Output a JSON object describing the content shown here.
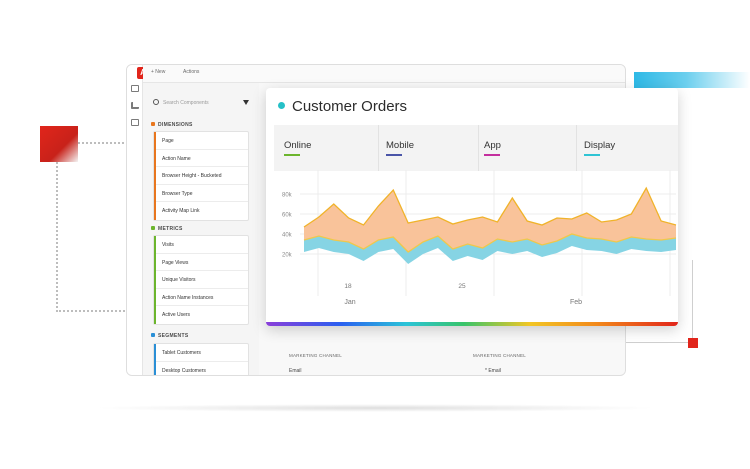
{
  "app": {
    "logo_letter": "A",
    "topbar": {
      "new_label": "+ New",
      "actions_label": "Actions"
    },
    "search": {
      "placeholder": "Search Components"
    },
    "sections": {
      "dimensions": {
        "title": "DIMENSIONS",
        "items": [
          "Page",
          "Action Name",
          "Browser Height - Bucketed",
          "Browser Type",
          "Activity Map Link"
        ]
      },
      "metrics": {
        "title": "METRICS",
        "items": [
          "Visits",
          "Page Views",
          "Unique Visitors",
          "Action Name Instances",
          "Active Users"
        ]
      },
      "segments": {
        "title": "SEGMENTS",
        "items": [
          "Tablet Customers",
          "Desktop Customers"
        ]
      }
    },
    "main_table": {
      "col1_header": "MARKETING CHANNEL",
      "col1_value": "Email",
      "col2_header": "MARKETING CHANNEL",
      "col2_value": "* Email"
    }
  },
  "chart_card": {
    "title": "Customer Orders",
    "legend": [
      {
        "label": "Online",
        "color": "#6cb52d"
      },
      {
        "label": "Mobile",
        "color": "#4a55a8"
      },
      {
        "label": "App",
        "color": "#c42f9e"
      },
      {
        "label": "Display",
        "color": "#2fc4d4"
      }
    ]
  },
  "colors": {
    "accent_red": "#e1251b",
    "upper_fill": "#f9c39a",
    "upper_line": "#f0b32a",
    "lower_fill": "#86d4e4",
    "lower_line": "#f0c84a"
  },
  "chart_data": {
    "type": "area",
    "x_ticks": [
      "18",
      "25",
      "",
      ""
    ],
    "x_month_labels": [
      "Jan",
      "Feb"
    ],
    "y_ticks": [
      "20k",
      "40k",
      "60k",
      "80k"
    ],
    "ylim": [
      0,
      100000
    ],
    "series": [
      {
        "values": [
          22000,
          26000,
          22000,
          20000,
          13000,
          22000,
          25000,
          10000,
          20000,
          26000,
          13000,
          18000,
          14000,
          23000,
          20000,
          23000,
          17000,
          21000,
          28000,
          24000,
          23000,
          20000,
          25000,
          23000,
          22000,
          24000
        ]
      },
      {
        "values": [
          47000,
          57000,
          70000,
          56000,
          49000,
          68000,
          84000,
          51000,
          54000,
          57000,
          50000,
          54000,
          57000,
          52000,
          76000,
          53000,
          49000,
          56000,
          55000,
          61000,
          52000,
          54000,
          60000,
          86000,
          53000,
          49000
        ]
      }
    ],
    "grid": true,
    "legend": "top"
  }
}
